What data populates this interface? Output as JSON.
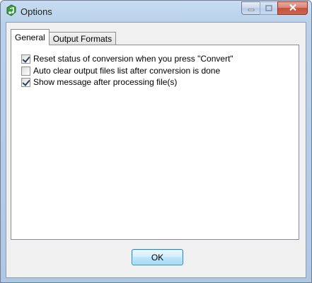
{
  "window": {
    "title": "Options",
    "icon": "app-icon"
  },
  "tabs": [
    {
      "label": "General",
      "active": true
    },
    {
      "label": "Output Formats",
      "active": false
    }
  ],
  "options": [
    {
      "label": "Reset status of conversion when you press \"Convert\"",
      "checked": true
    },
    {
      "label": "Auto clear output files list after conversion is done",
      "checked": false
    },
    {
      "label": "Show message after processing file(s)",
      "checked": true
    }
  ],
  "buttons": {
    "ok_label": "OK"
  },
  "colors": {
    "frame": "#b9d1ea",
    "close": "#c4523b",
    "ok_border": "#3c7fb1"
  }
}
